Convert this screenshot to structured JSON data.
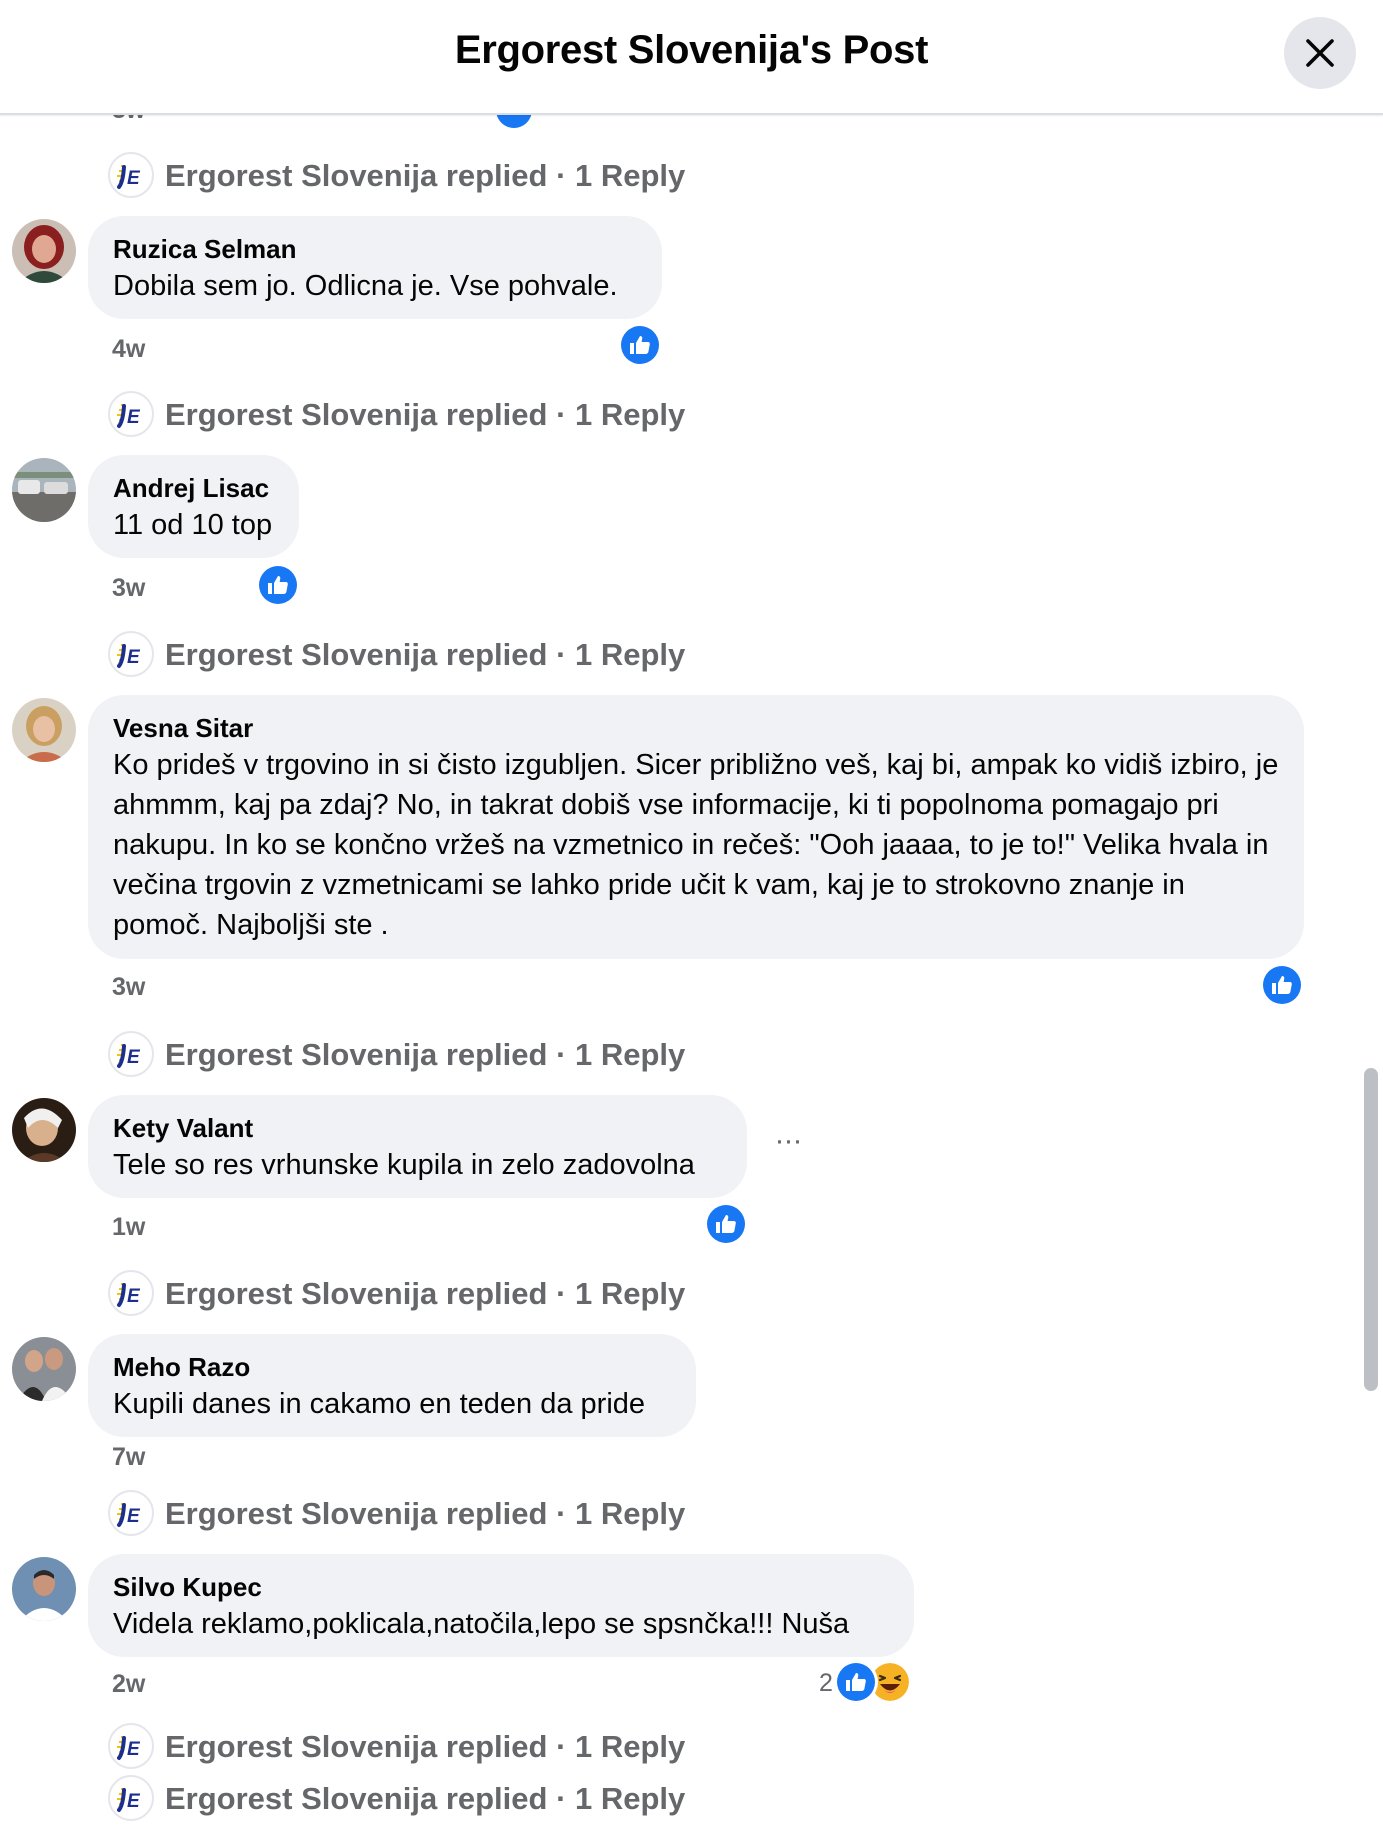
{
  "header": {
    "title": "Ergorest Slovenija's Post"
  },
  "top_stub": {
    "time": "3w"
  },
  "reply_label": "Ergorest Slovenija replied · 1 Reply",
  "comments": [
    {
      "author": "Ruzica Selman",
      "text": "Dobila sem jo. Odlicna je. Vse pohvale.",
      "time": "4w",
      "reactions": [
        "like"
      ]
    },
    {
      "author": "Andrej Lisac",
      "text": "11 od 10 top",
      "time": "3w",
      "reactions": [
        "like"
      ]
    },
    {
      "author": "Vesna Sitar",
      "text": "Ko prideš v trgovino in si čisto izgubljen. Sicer približno veš, kaj bi, ampak ko vidiš izbiro, je ahmmm, kaj pa zdaj? No, in takrat dobiš vse informacije, ki ti popolnoma pomagajo pri nakupu. In ko se končno vržeš na vzmetnico in rečeš: \"Ooh jaaaa, to je to!\" Velika hvala in večina trgovin z vzmetnicami se lahko pride učit k vam, kaj je to strokovno znanje in pomoč. Najboljši ste .",
      "time": "3w",
      "reactions": [
        "like"
      ]
    },
    {
      "author": "Kety Valant",
      "text": "Tele so res vrhunske kupila in zelo zadovolna",
      "time": "1w",
      "reactions": [
        "like"
      ],
      "more": "···"
    },
    {
      "author": "Meho Razo",
      "text": "Kupili danes in cakamo en teden da pride",
      "time": "7w",
      "reactions": []
    },
    {
      "author": "Silvo Kupec",
      "text": "Videla reklamo,poklicala,natočila,lepo se spsnčka!!! Nuša",
      "time": "2w",
      "reactions": [
        "like",
        "haha"
      ],
      "reaction_count": "2"
    }
  ],
  "icons": [
    "close-icon",
    "page-logo-icon",
    "like-icon",
    "haha-icon",
    "more-icon"
  ],
  "colors": {
    "accent": "#1877f2",
    "bubble": "#f0f2f5",
    "secondary_text": "#65676b"
  }
}
